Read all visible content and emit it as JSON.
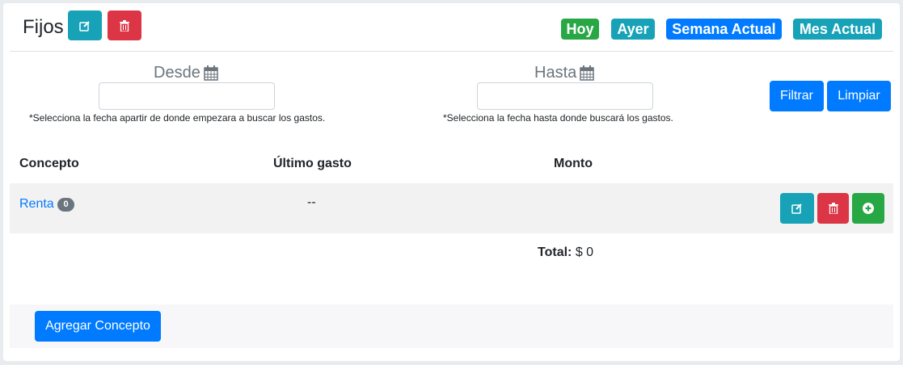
{
  "header": {
    "title": "Fijos",
    "edit_icon": "edit-icon",
    "delete_icon": "trash-icon"
  },
  "quick_filters": {
    "today": "Hoy",
    "yesterday": "Ayer",
    "this_week": "Semana Actual",
    "this_month": "Mes Actual"
  },
  "filters": {
    "from_label": "Desde",
    "from_value": "",
    "from_hint": "*Selecciona la fecha apartir de donde empezara a buscar los gastos.",
    "to_label": "Hasta",
    "to_value": "",
    "to_hint": "*Selecciona la fecha hasta donde buscará los gastos.",
    "calendar_icon": "calendar-icon",
    "filter_button": "Filtrar",
    "clear_button": "Limpiar"
  },
  "table": {
    "columns": [
      "Concepto",
      "Último gasto",
      "Monto"
    ],
    "rows": [
      {
        "concept": "Renta",
        "count": "0",
        "last_expense": "--",
        "amount": ""
      }
    ],
    "row_actions": [
      "edit-icon",
      "trash-icon",
      "plus-circle-icon"
    ],
    "total_label": "Total:",
    "total_value": "$ 0"
  },
  "footer": {
    "add_button": "Agregar Concepto"
  },
  "colors": {
    "teal": "#17a2b8",
    "red": "#dc3545",
    "green": "#28a745",
    "blue": "#007bff",
    "gray": "#6c757d"
  }
}
